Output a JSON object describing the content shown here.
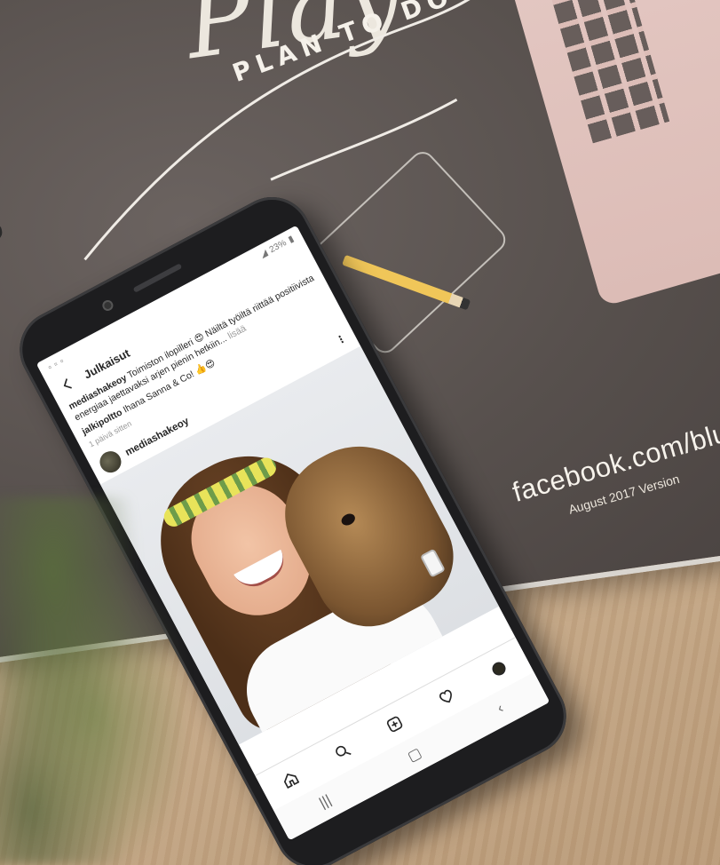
{
  "planner": {
    "title": "Play",
    "tagline": "PLAN TO DO GREAT TH",
    "url": "facebook.com/bluep",
    "version": "August 2017 Version"
  },
  "phone": {
    "status_bar": {
      "battery": "23%"
    },
    "header": {
      "title": "Julkaisut"
    },
    "post": {
      "caption_user": "mediashakeoy",
      "caption_text": "Toimiston ilopilleri 😍 Näiltä työiltä riittää positiivista energiaa jaettavaksi arjen pienin hetkiin...",
      "caption_more": "lisää",
      "comment_user": "jalkipoltto",
      "comment_text": "Ihana Sanna & Co! 👍😍",
      "time": "1 päivä sitten",
      "owner": "mediashakeoy"
    }
  },
  "colors": {
    "planner_bg": "#57504d",
    "table_wood": "#cdb292",
    "laptop": "#dcbcb6",
    "phone_body": "#1d1d1f",
    "screen_bg": "#ffffff"
  }
}
